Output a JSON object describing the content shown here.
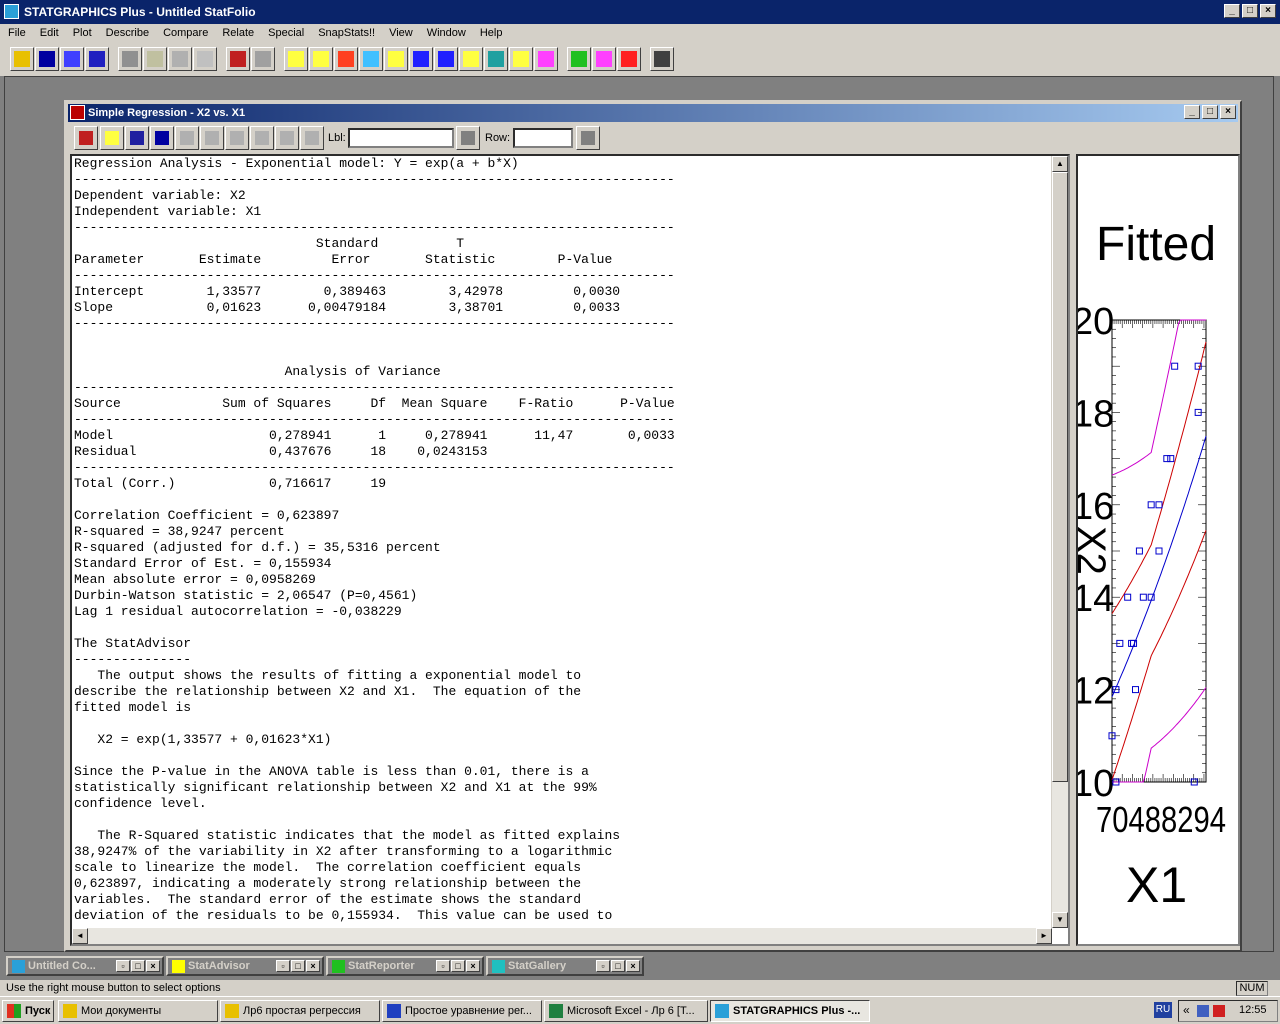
{
  "app": {
    "title": "STATGRAPHICS Plus - Untitled StatFolio",
    "menu": [
      "File",
      "Edit",
      "Plot",
      "Describe",
      "Compare",
      "Relate",
      "Special",
      "SnapStats!!",
      "View",
      "Window",
      "Help"
    ]
  },
  "child": {
    "title": "Simple Regression - X2 vs. X1",
    "lbl_label": "Lbl:",
    "row_label": "Row:"
  },
  "output_lines": [
    "Regression Analysis - Exponential model: Y = exp(a + b*X)",
    "-----------------------------------------------------------------------------",
    "Dependent variable: X2",
    "Independent variable: X1",
    "-----------------------------------------------------------------------------",
    "                               Standard          T",
    "Parameter       Estimate         Error       Statistic        P-Value",
    "-----------------------------------------------------------------------------",
    "Intercept        1,33577        0,389463        3,42978         0,0030",
    "Slope            0,01623      0,00479184        3,38701         0,0033",
    "-----------------------------------------------------------------------------",
    "",
    "",
    "                           Analysis of Variance",
    "-----------------------------------------------------------------------------",
    "Source             Sum of Squares     Df  Mean Square    F-Ratio      P-Value",
    "-----------------------------------------------------------------------------",
    "Model                    0,278941      1     0,278941      11,47       0,0033",
    "Residual                 0,437676     18    0,0243153",
    "-----------------------------------------------------------------------------",
    "Total (Corr.)            0,716617     19",
    "",
    "Correlation Coefficient = 0,623897",
    "R-squared = 38,9247 percent",
    "R-squared (adjusted for d.f.) = 35,5316 percent",
    "Standard Error of Est. = 0,155934",
    "Mean absolute error = 0,0958269",
    "Durbin-Watson statistic = 2,06547 (P=0,4561)",
    "Lag 1 residual autocorrelation = -0,038229",
    "",
    "The StatAdvisor",
    "---------------",
    "   The output shows the results of fitting a exponential model to",
    "describe the relationship between X2 and X1.  The equation of the",
    "fitted model is",
    "",
    "   X2 = exp(1,33577 + 0,01623*X1)",
    "",
    "Since the P-value in the ANOVA table is less than 0.01, there is a",
    "statistically significant relationship between X2 and X1 at the 99%",
    "confidence level.",
    "",
    "   The R-Squared statistic indicates that the model as fitted explains",
    "38,9247% of the variability in X2 after transforming to a logarithmic",
    "scale to linearize the model.  The correlation coefficient equals",
    "0,623897, indicating a moderately strong relationship between the",
    "variables.  The standard error of the estimate shows the standard",
    "deviation of the residuals to be 0,155934.  This value can be used to"
  ],
  "graph": {
    "title_fragment": "Fitted",
    "ylabel_fragment": "X2",
    "xlabel": "X1",
    "x_tick_fragment": "70488294",
    "y_ticks": [
      "20",
      "18",
      "16",
      "14",
      "12",
      "10"
    ]
  },
  "chart_data": {
    "type": "scatter",
    "title": "Fitted",
    "xlabel": "X1",
    "ylabel": "X2",
    "ylim": [
      10,
      20
    ],
    "xlim": [
      70,
      94
    ],
    "points": [
      [
        70,
        11
      ],
      [
        71,
        10
      ],
      [
        71,
        12
      ],
      [
        72,
        13
      ],
      [
        74,
        14
      ],
      [
        75,
        13
      ],
      [
        75.5,
        13
      ],
      [
        76,
        12
      ],
      [
        77,
        15
      ],
      [
        78,
        14
      ],
      [
        80,
        14
      ],
      [
        80,
        16
      ],
      [
        82,
        15
      ],
      [
        82,
        16
      ],
      [
        84,
        17
      ],
      [
        85,
        17
      ],
      [
        86,
        19
      ],
      [
        92,
        19
      ],
      [
        92,
        18
      ],
      [
        91,
        10
      ]
    ],
    "series": [
      {
        "name": "fitted",
        "color": "#0000cc"
      },
      {
        "name": "confidence limits",
        "color": "#cc0000"
      },
      {
        "name": "prediction limits",
        "color": "#cc00cc"
      }
    ]
  },
  "minimized": [
    {
      "title": "Untitled Co..."
    },
    {
      "title": "StatAdvisor"
    },
    {
      "title": "StatReporter"
    },
    {
      "title": "StatGallery"
    }
  ],
  "status": {
    "hint": "Use the right mouse button to select options",
    "num": "NUM"
  },
  "taskbar": {
    "start": "Пуск",
    "items": [
      "Мои документы",
      "Лр6 простая регрессия",
      "Простое уравнение рег...",
      "Microsoft Excel - Лр 6  [Т...",
      "STATGRAPHICS Plus -..."
    ],
    "lang": "RU",
    "clock": "12:55"
  }
}
